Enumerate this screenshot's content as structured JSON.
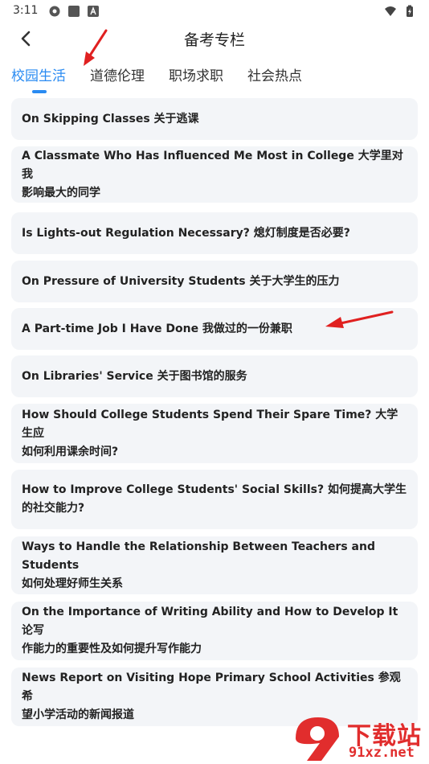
{
  "status_bar": {
    "time": "3:11",
    "icons_left": [
      "settings-gear-icon",
      "square-icon",
      "font-a-icon"
    ],
    "icons_right": [
      "wifi-icon",
      "battery-charging-icon"
    ]
  },
  "header": {
    "title": "备考专栏",
    "back_icon": "chevron-left-icon"
  },
  "tabs": [
    {
      "label": "校园生活",
      "active": true
    },
    {
      "label": "道德伦理",
      "active": false
    },
    {
      "label": "职场求职",
      "active": false
    },
    {
      "label": "社会热点",
      "active": false
    }
  ],
  "items": [
    {
      "line1": "On Skipping Classes  关于逃课",
      "line2": ""
    },
    {
      "line1": "A Classmate Who Has Influenced Me Most in College 大学里对我",
      "line2": "影响最大的同学"
    },
    {
      "line1": "Is Lights-out Regulation Necessary? 熄灯制度是否必要?",
      "line2": ""
    },
    {
      "line1": "On Pressure of University Students 关于大学生的压力",
      "line2": ""
    },
    {
      "line1": "A Part-time Job I Have Done 我做过的一份兼职",
      "line2": ""
    },
    {
      "line1": "On Libraries' Service 关于图书馆的服务",
      "line2": ""
    },
    {
      "line1": "How Should College Students Spend Their Spare Time? 大学生应",
      "line2": "如何利用课余时间?"
    },
    {
      "line1": "How to Improve College Students' Social Skills? 如何提高大学生",
      "line2": "的社交能力?"
    },
    {
      "line1": "Ways to Handle the Relationship Between Teachers and Students",
      "line2": "如何处理好师生关系"
    },
    {
      "line1": "On the Importance of Writing Ability and How to Develop It 论写",
      "line2": "作能力的重要性及如何提升写作能力"
    },
    {
      "line1": "News Report on Visiting Hope Primary School Activities 参观希",
      "line2": "望小学活动的新闻报道"
    }
  ],
  "watermark": {
    "logo_text": "下载站",
    "site": "91xz.net"
  },
  "colors": {
    "accent": "#2a8bf2",
    "card_bg": "#f3f5f8",
    "annotation_arrow": "#e02020"
  }
}
